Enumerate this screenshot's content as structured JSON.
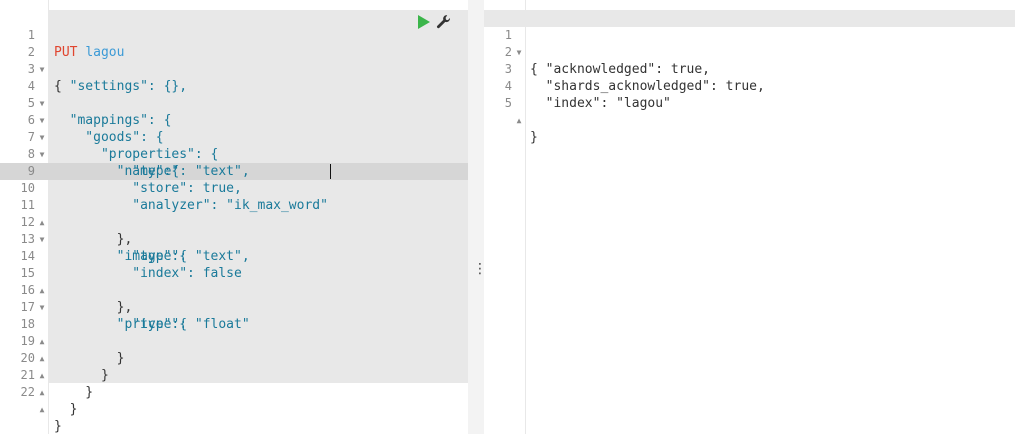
{
  "request": {
    "method": "PUT",
    "index": "lagou",
    "run_icon": "play-icon",
    "settings_icon": "wrench-icon",
    "line_numbers": [
      "1",
      "2",
      "3",
      "4",
      "5",
      "6",
      "7",
      "8",
      "9",
      "10",
      "11",
      "12",
      "13",
      "14",
      "15",
      "16",
      "17",
      "18",
      "19",
      "20",
      "21",
      "22"
    ],
    "lines": [
      "{",
      "  \"settings\": {},",
      "  \"mappings\": {",
      "    \"goods\": {",
      "      \"properties\": {",
      "        \"name\":{",
      "          \"type\": \"text\",",
      "          \"store\": true,",
      "          \"analyzer\": \"ik_max_word\"",
      "        },",
      "        \"image\":{",
      "          \"type\": \"text\",",
      "          \"index\": false",
      "        },",
      "        \"price\":{",
      "          \"type\": \"float\"",
      "        }",
      "      }",
      "    }",
      "  }",
      "}"
    ]
  },
  "splitter": {
    "icon": "vertical-dots-icon",
    "glyph": "⋮"
  },
  "response": {
    "line_numbers": [
      "1",
      "2",
      "3",
      "4",
      "5"
    ],
    "lines": [
      "{",
      "  \"acknowledged\": true,",
      "  \"shards_acknowledged\": true,",
      "  \"index\": \"lagou\"",
      "}"
    ]
  }
}
